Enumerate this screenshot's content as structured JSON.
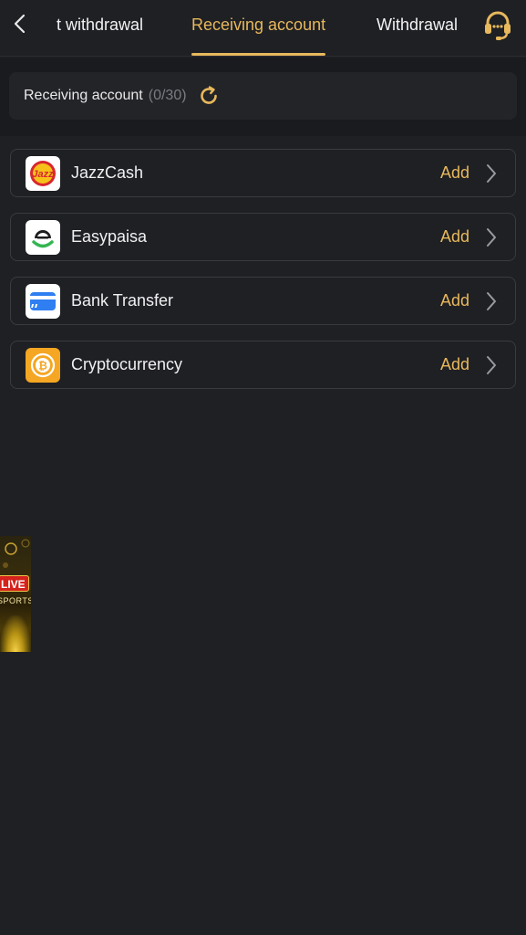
{
  "header": {
    "tabs": [
      {
        "label": "t withdrawal"
      },
      {
        "label": "Receiving account"
      },
      {
        "label": "Withdrawal"
      }
    ],
    "active_tab": "Receiving account"
  },
  "summary": {
    "title": "Receiving account",
    "count": "(0/30)"
  },
  "accounts": [
    {
      "label": "JazzCash",
      "action": "Add",
      "icon": "jazzcash-logo"
    },
    {
      "label": "Easypaisa",
      "action": "Add",
      "icon": "easypaisa-logo"
    },
    {
      "label": "Bank Transfer",
      "action": "Add",
      "icon": "bank-card-icon"
    },
    {
      "label": "Cryptocurrency",
      "action": "Add",
      "icon": "bitcoin-icon"
    }
  ],
  "banner": {
    "badge": "LIVE",
    "text": "SPORTS"
  },
  "colors": {
    "accent": "#e7b85c",
    "background": "#1f2024",
    "border": "#3a3b40"
  }
}
